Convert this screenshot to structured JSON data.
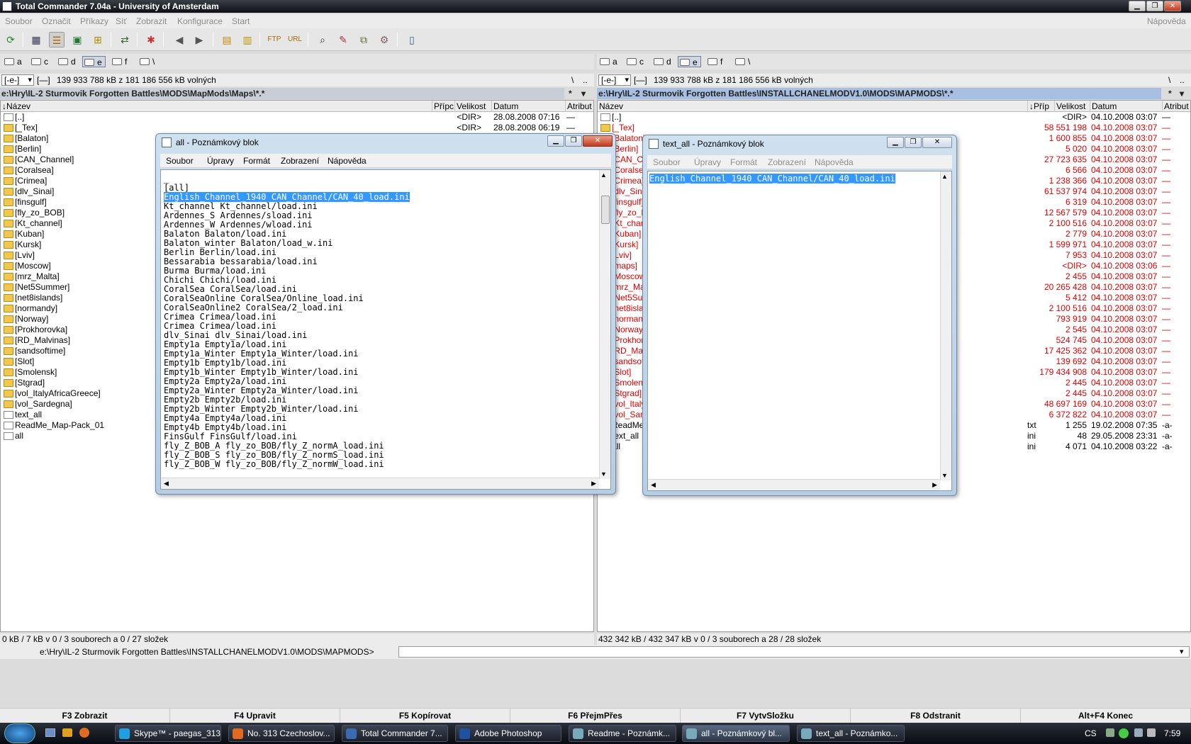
{
  "window": {
    "title": "Total Commander 7.04a - University of Amsterdam"
  },
  "menu": {
    "items": [
      "Soubor",
      "Označit",
      "Příkazy",
      "Síť",
      "Zobrazit",
      "Konfigurace",
      "Start"
    ],
    "help": "Nápověda"
  },
  "drives": [
    "a",
    "c",
    "d",
    "e",
    "f",
    "\\"
  ],
  "left": {
    "drive_combo": "[-e-]",
    "drive_label": "[—]",
    "free": "139 933 788 kB z 181 186 556 kB volných",
    "path": "e:\\Hry\\IL-2 Sturmovik Forgotten Battles\\MODS\\MapMods\\Maps\\*.*",
    "cols": {
      "name": "↓Název",
      "ext": "Přípc",
      "size": "Velikost",
      "date": "Datum",
      "attr": "Atribut"
    },
    "rows": [
      {
        "icon": "up",
        "name": "[..]",
        "ext": "",
        "size": "<DIR>",
        "date": "28.08.2008 07:16",
        "attr": "—"
      },
      {
        "icon": "folder",
        "name": "[_Tex]",
        "ext": "",
        "size": "<DIR>",
        "date": "28.08.2008 06:19",
        "attr": "—"
      },
      {
        "icon": "folder",
        "name": "[Balaton]",
        "ext": "",
        "size": "",
        "date": "",
        "attr": ""
      },
      {
        "icon": "folder",
        "name": "[Berlin]",
        "ext": "",
        "size": "",
        "date": "",
        "attr": ""
      },
      {
        "icon": "folder",
        "name": "[CAN_Channel]",
        "ext": "",
        "size": "",
        "date": "",
        "attr": ""
      },
      {
        "icon": "folder",
        "name": "[Coralsea]",
        "ext": "",
        "size": "",
        "date": "",
        "attr": ""
      },
      {
        "icon": "folder",
        "name": "[Crimea]",
        "ext": "",
        "size": "",
        "date": "",
        "attr": ""
      },
      {
        "icon": "folder",
        "name": "[dlv_Sinai]",
        "ext": "",
        "size": "",
        "date": "",
        "attr": ""
      },
      {
        "icon": "folder",
        "name": "[finsgulf]",
        "ext": "",
        "size": "",
        "date": "",
        "attr": ""
      },
      {
        "icon": "folder",
        "name": "[fly_zo_BOB]",
        "ext": "",
        "size": "",
        "date": "",
        "attr": ""
      },
      {
        "icon": "folder",
        "name": "[Kt_channel]",
        "ext": "",
        "size": "",
        "date": "",
        "attr": ""
      },
      {
        "icon": "folder",
        "name": "[Kuban]",
        "ext": "",
        "size": "",
        "date": "",
        "attr": ""
      },
      {
        "icon": "folder",
        "name": "[Kursk]",
        "ext": "",
        "size": "",
        "date": "",
        "attr": ""
      },
      {
        "icon": "folder",
        "name": "[Lviv]",
        "ext": "",
        "size": "",
        "date": "",
        "attr": ""
      },
      {
        "icon": "folder",
        "name": "[Moscow]",
        "ext": "",
        "size": "",
        "date": "",
        "attr": ""
      },
      {
        "icon": "folder",
        "name": "[mrz_Malta]",
        "ext": "",
        "size": "",
        "date": "",
        "attr": ""
      },
      {
        "icon": "folder",
        "name": "[Net5Summer]",
        "ext": "",
        "size": "",
        "date": "",
        "attr": ""
      },
      {
        "icon": "folder",
        "name": "[net8islands]",
        "ext": "",
        "size": "",
        "date": "",
        "attr": ""
      },
      {
        "icon": "folder",
        "name": "[normandy]",
        "ext": "",
        "size": "",
        "date": "",
        "attr": ""
      },
      {
        "icon": "folder",
        "name": "[Norway]",
        "ext": "",
        "size": "",
        "date": "",
        "attr": ""
      },
      {
        "icon": "folder",
        "name": "[Prokhorovka]",
        "ext": "",
        "size": "",
        "date": "",
        "attr": ""
      },
      {
        "icon": "folder",
        "name": "[RD_Malvinas]",
        "ext": "",
        "size": "",
        "date": "",
        "attr": ""
      },
      {
        "icon": "folder",
        "name": "[sandsoftime]",
        "ext": "",
        "size": "",
        "date": "",
        "attr": ""
      },
      {
        "icon": "folder",
        "name": "[Slot]",
        "ext": "",
        "size": "",
        "date": "",
        "attr": ""
      },
      {
        "icon": "folder",
        "name": "[Smolensk]",
        "ext": "",
        "size": "",
        "date": "",
        "attr": ""
      },
      {
        "icon": "folder",
        "name": "[Stgrad]",
        "ext": "",
        "size": "",
        "date": "",
        "attr": ""
      },
      {
        "icon": "folder",
        "name": "[vol_ItalyAfricaGreece]",
        "ext": "",
        "size": "",
        "date": "",
        "attr": ""
      },
      {
        "icon": "folder",
        "name": "[vol_Sardegna]",
        "ext": "",
        "size": "",
        "date": "",
        "attr": ""
      },
      {
        "icon": "ini",
        "name": "text_all",
        "ext": "",
        "size": "",
        "date": "",
        "attr": ""
      },
      {
        "icon": "doc",
        "name": "ReadMe_Map-Pack_01",
        "ext": "",
        "size": "",
        "date": "",
        "attr": ""
      },
      {
        "icon": "ini",
        "name": "all",
        "ext": "",
        "size": "",
        "date": "",
        "attr": ""
      }
    ],
    "status": "0 kB / 7 kB v 0 / 3 souborech a 0 / 27 složek"
  },
  "right": {
    "drive_combo": "[-e-]",
    "drive_label": "[—]",
    "free": "139 933 788 kB z 181 186 556 kB volných",
    "path": "e:\\Hry\\IL-2 Sturmovik Forgotten Battles\\INSTALLCHANELMODV1.0\\MODS\\MAPMODS\\*.*",
    "cols": {
      "name": "Název",
      "ext": "↓Příp",
      "size": "Velikost",
      "date": "Datum",
      "attr": "Atribut"
    },
    "rows": [
      {
        "icon": "up",
        "name": "[..]",
        "ext": "",
        "size": "<DIR>",
        "date": "04.10.2008 03:07",
        "attr": "—",
        "red": false
      },
      {
        "icon": "folder",
        "name": "[_Tex]",
        "ext": "",
        "size": "58 551 198",
        "date": "04.10.2008 03:07",
        "attr": "—",
        "red": true
      },
      {
        "icon": "folder",
        "name": "[Balaton]",
        "ext": "",
        "size": "1 600 855",
        "date": "04.10.2008 03:07",
        "attr": "—",
        "red": true
      },
      {
        "icon": "folder",
        "name": "[Berlin]",
        "ext": "",
        "size": "5 020",
        "date": "04.10.2008 03:07",
        "attr": "—",
        "red": true
      },
      {
        "icon": "folder",
        "name": "[CAN_Channel]",
        "ext": "",
        "size": "27 723 635",
        "date": "04.10.2008 03:07",
        "attr": "—",
        "red": true
      },
      {
        "icon": "folder",
        "name": "[Coralsea]",
        "ext": "",
        "size": "6 566",
        "date": "04.10.2008 03:07",
        "attr": "—",
        "red": true
      },
      {
        "icon": "folder",
        "name": "[Crimea]",
        "ext": "",
        "size": "1 238 366",
        "date": "04.10.2008 03:07",
        "attr": "—",
        "red": true
      },
      {
        "icon": "folder",
        "name": "[dlv_Sinai]",
        "ext": "",
        "size": "61 537 974",
        "date": "04.10.2008 03:07",
        "attr": "—",
        "red": true
      },
      {
        "icon": "folder",
        "name": "[finsgulf]",
        "ext": "",
        "size": "6 319",
        "date": "04.10.2008 03:07",
        "attr": "—",
        "red": true
      },
      {
        "icon": "folder",
        "name": "[fly_zo_BOB]",
        "ext": "",
        "size": "12 567 579",
        "date": "04.10.2008 03:07",
        "attr": "—",
        "red": true
      },
      {
        "icon": "folder",
        "name": "[Kt_channel]",
        "ext": "",
        "size": "2 100 516",
        "date": "04.10.2008 03:07",
        "attr": "—",
        "red": true
      },
      {
        "icon": "folder",
        "name": "[Kuban]",
        "ext": "",
        "size": "2 779",
        "date": "04.10.2008 03:07",
        "attr": "—",
        "red": true
      },
      {
        "icon": "folder",
        "name": "[Kursk]",
        "ext": "",
        "size": "1 599 971",
        "date": "04.10.2008 03:07",
        "attr": "—",
        "red": true
      },
      {
        "icon": "folder",
        "name": "[Lviv]",
        "ext": "",
        "size": "7 953",
        "date": "04.10.2008 03:07",
        "attr": "—",
        "red": true
      },
      {
        "icon": "folder",
        "name": "[maps]",
        "ext": "",
        "size": "<DIR>",
        "date": "04.10.2008 03:06",
        "attr": "—",
        "red": true
      },
      {
        "icon": "folder",
        "name": "[Moscow]",
        "ext": "",
        "size": "2 455",
        "date": "04.10.2008 03:07",
        "attr": "—",
        "red": true
      },
      {
        "icon": "folder",
        "name": "[mrz_Malta]",
        "ext": "",
        "size": "20 265 428",
        "date": "04.10.2008 03:07",
        "attr": "—",
        "red": true
      },
      {
        "icon": "folder",
        "name": "[Net5Summer]",
        "ext": "",
        "size": "5 412",
        "date": "04.10.2008 03:07",
        "attr": "—",
        "red": true
      },
      {
        "icon": "folder",
        "name": "[net8islands]",
        "ext": "",
        "size": "2 100 516",
        "date": "04.10.2008 03:07",
        "attr": "—",
        "red": true
      },
      {
        "icon": "folder",
        "name": "[normandy]",
        "ext": "",
        "size": "793 919",
        "date": "04.10.2008 03:07",
        "attr": "—",
        "red": true
      },
      {
        "icon": "folder",
        "name": "[Norway]",
        "ext": "",
        "size": "2 545",
        "date": "04.10.2008 03:07",
        "attr": "—",
        "red": true
      },
      {
        "icon": "folder",
        "name": "[Prokhorovka]",
        "ext": "",
        "size": "524 745",
        "date": "04.10.2008 03:07",
        "attr": "—",
        "red": true
      },
      {
        "icon": "folder",
        "name": "[RD_Malvinas]",
        "ext": "",
        "size": "17 425 362",
        "date": "04.10.2008 03:07",
        "attr": "—",
        "red": true
      },
      {
        "icon": "folder",
        "name": "[sandsoftime]",
        "ext": "",
        "size": "139 692",
        "date": "04.10.2008 03:07",
        "attr": "—",
        "red": true
      },
      {
        "icon": "folder",
        "name": "[Slot]",
        "ext": "",
        "size": "179 434 908",
        "date": "04.10.2008 03:07",
        "attr": "—",
        "red": true
      },
      {
        "icon": "folder",
        "name": "[Smolensk]",
        "ext": "",
        "size": "2 445",
        "date": "04.10.2008 03:07",
        "attr": "—",
        "red": true
      },
      {
        "icon": "folder",
        "name": "[Stgrad]",
        "ext": "",
        "size": "2 445",
        "date": "04.10.2008 03:07",
        "attr": "—",
        "red": true
      },
      {
        "icon": "folder",
        "name": "[vol_Italy]",
        "ext": "",
        "size": "48 697 169",
        "date": "04.10.2008 03:07",
        "attr": "—",
        "red": true
      },
      {
        "icon": "folder",
        "name": "[vol_Sardegna]",
        "ext": "",
        "size": "6 372 822",
        "date": "04.10.2008 03:07",
        "attr": "—",
        "red": true
      },
      {
        "icon": "doc",
        "name": "ReadMe",
        "ext": "txt",
        "size": "1 255",
        "date": "19.02.2008 07:35",
        "attr": "-a-",
        "red": false
      },
      {
        "icon": "ini",
        "name": "text_all",
        "ext": "ini",
        "size": "48",
        "date": "29.05.2008 23:31",
        "attr": "-a-",
        "red": false
      },
      {
        "icon": "ini",
        "name": "all",
        "ext": "ini",
        "size": "4 071",
        "date": "04.10.2008 03:22",
        "attr": "-a-",
        "red": false
      }
    ],
    "status": "432 342 kB / 432 347 kB v 0 / 3 souborech a 28 / 28 složek"
  },
  "cmdline": {
    "path": "e:\\Hry\\IL-2 Sturmovik Forgotten Battles\\INSTALLCHANELMODV1.0\\MODS\\MAPMODS>"
  },
  "fkeys": [
    "F3 Zobrazit",
    "F4 Upravit",
    "F5 Kopírovat",
    "F6 PřejmPřes",
    "F7 VytvSložku",
    "F8 Odstranit",
    "Alt+F4 Konec"
  ],
  "notepad1": {
    "title": "all - Poznámkový blok",
    "menu": [
      "Soubor",
      "Úpravy",
      "Formát",
      "Zobrazení",
      "Nápověda"
    ],
    "lines": [
      "_",
      "[all]",
      "English_Channel_1940 CAN_Channel/CAN_40_load.ini",
      "Kt_channel Kt_channel/load.ini",
      "Ardennes_S Ardennes/sload.ini",
      "Ardennes_W Ardennes/wload.ini",
      "Balaton Balaton/load.ini",
      "Balaton_winter Balaton/load_w.ini",
      "Berlin Berlin/load.ini",
      "Bessarabia bessarabia/load.ini",
      "Burma Burma/load.ini",
      "Chichi Chichi/load.ini",
      "CoralSea CoralSea/load.ini",
      "CoralSeaOnline CoralSea/Online_load.ini",
      "CoralSeaOnline2 CoralSea/2_load.ini",
      "Crimea Crimea/load.ini",
      "Crimea Crimea/load.ini",
      "dlv_Sinai dlv_Sinai/load.ini",
      "Empty1a Empty1a/load.ini",
      "Empty1a_Winter Empty1a_Winter/load.ini",
      "Empty1b Empty1b/load.ini",
      "Empty1b_Winter Empty1b_Winter/load.ini",
      "Empty2a Empty2a/load.ini",
      "Empty2a_Winter Empty2a_Winter/load.ini",
      "Empty2b Empty2b/load.ini",
      "Empty2b_Winter Empty2b_Winter/load.ini",
      "Empty4a Empty4a/load.ini",
      "Empty4b Empty4b/load.ini",
      "FinsGulf FinsGulf/load.ini",
      "fly_Z_BOB_A fly_zo_BOB/fly_Z_normA_load.ini",
      "fly_Z_BOB_S fly_zo_BOB/fly_Z_normS_load.ini",
      "fly_Z_BOB_W fly_zo_BOB/fly_Z_normW_load.ini"
    ]
  },
  "notepad2": {
    "title": "text_all - Poznámkový blok",
    "menu": [
      "Soubor",
      "Úpravy",
      "Formát",
      "Zobrazení",
      "Nápověda"
    ],
    "lines": [
      "English_Channel_1940 CAN_Channel/CAN_40_load.ini"
    ]
  },
  "taskbar": {
    "items": [
      "Skype™ - paegas_313",
      "No. 313 Czechoslov...",
      "Total Commander 7...",
      "Adobe Photoshop",
      "Readme - Poznámk...",
      "all - Poznámkový bl...",
      "text_all - Poznámko..."
    ],
    "lang": "CS",
    "clock": "7:59"
  },
  "colors": {
    "red": "#e00000",
    "selection": "#3399ff"
  }
}
